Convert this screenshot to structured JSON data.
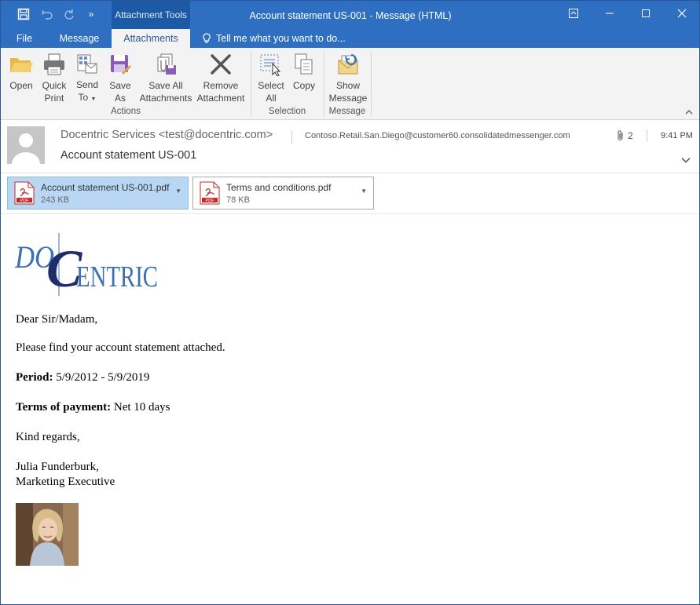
{
  "window": {
    "context_tab": "Attachment Tools",
    "title": "Account statement US-001 - Message (HTML)"
  },
  "tabs": {
    "file": "File",
    "message": "Message",
    "attachments": "Attachments",
    "tell_me": "Tell me what you want to do..."
  },
  "ribbon": {
    "open": "Open",
    "quick_print_1": "Quick",
    "quick_print_2": "Print",
    "send_to_1": "Send",
    "send_to_2": "To",
    "save_as_1": "Save",
    "save_as_2": "As",
    "save_all_1": "Save All",
    "save_all_2": "Attachments",
    "remove_1": "Remove",
    "remove_2": "Attachment",
    "select_all_1": "Select",
    "select_all_2": "All",
    "copy": "Copy",
    "show_message_1": "Show",
    "show_message_2": "Message",
    "group_actions": "Actions",
    "group_selection": "Selection",
    "group_message": "Message"
  },
  "header": {
    "from": "Docentric Services <test@docentric.com>",
    "subject": "Account statement US-001",
    "to": "Contoso.Retail.San.Diego@customer60.consolidatedmessenger.com",
    "attachment_count": "2",
    "time": "9:41 PM"
  },
  "attachments": [
    {
      "name": "Account statement US-001.pdf",
      "size": "243 KB"
    },
    {
      "name": "Terms and conditions.pdf",
      "size": "78 KB"
    }
  ],
  "body": {
    "logo_text_1": "DO",
    "logo_text_2": "C",
    "logo_text_3": "ENTRIC",
    "greeting": "Dear Sir/Madam,",
    "intro": "Please find your account statement attached.",
    "period_label": "Period:",
    "period_value": " 5/9/2012 - 5/9/2019",
    "terms_label": "Terms of payment:",
    "terms_value": " Net 10 days",
    "closing": "Kind regards,",
    "signature_name": "Julia Funderburk,",
    "signature_title": "Marketing Executive"
  },
  "colors": {
    "titlebar": "#2f6fc1",
    "selected_attachment": "#b9d7f2",
    "logo_blue": "#3a6fb5",
    "logo_dark": "#1f2d6b"
  }
}
